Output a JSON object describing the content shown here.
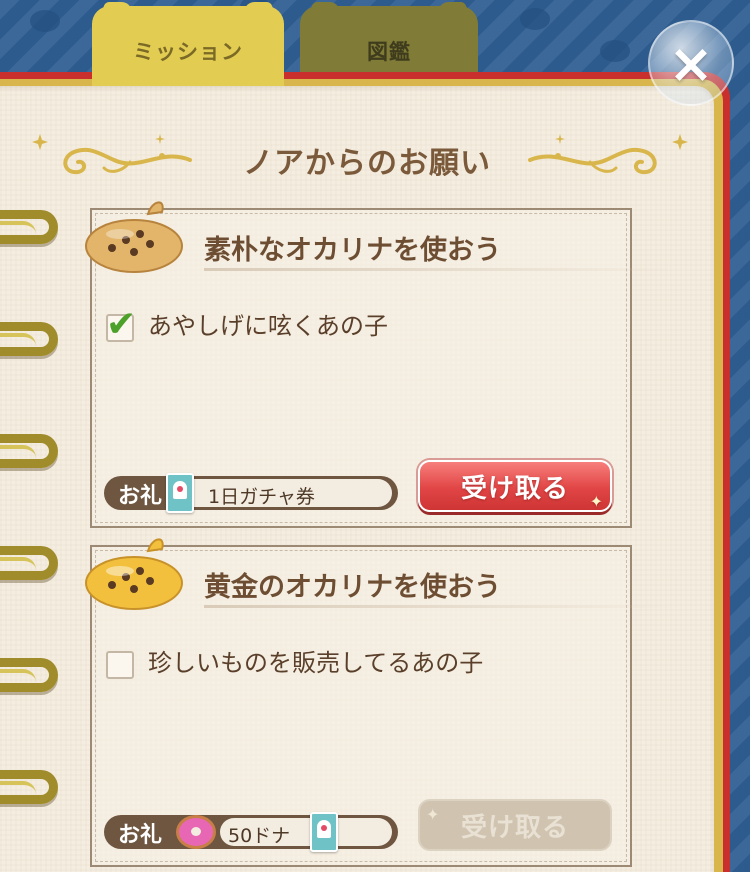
{
  "tabs": [
    {
      "label": "ミッション",
      "active": true
    },
    {
      "label": "図鑑",
      "active": false
    }
  ],
  "close_label": "×",
  "heading": "ノアからのお願い",
  "reward_label": "お礼",
  "missions": [
    {
      "title": "素朴なオカリナを使おう",
      "ocarina_color": "#e2b56b",
      "task": "あやしげに呟くあの子",
      "completed": true,
      "reward": "1日ガチャ券",
      "reward_icon": "gacha-ticket-icon",
      "button": "受け取る",
      "button_enabled": true
    },
    {
      "title": "黄金のオカリナを使おう",
      "ocarina_color": "#f2c03c",
      "task": "珍しいものを販売してるあの子",
      "completed": false,
      "reward": "50ドナ",
      "reward_icon": "donut-icon",
      "button": "受け取る",
      "button_enabled": false
    }
  ],
  "colors": {
    "background": "#2f5f93",
    "paper": "#f4ede0",
    "tab_active": "#e2cc52",
    "tab_inactive": "#807b36",
    "button_active": "#e14545",
    "button_disabled": "#d0c4b1",
    "check": "#4da12b"
  }
}
